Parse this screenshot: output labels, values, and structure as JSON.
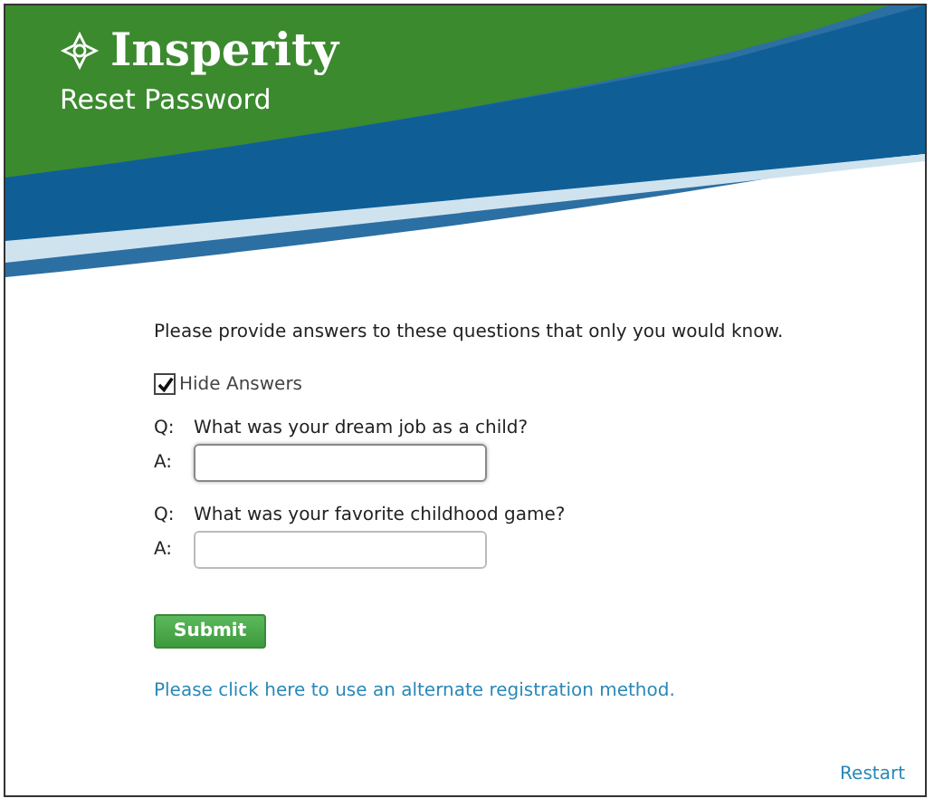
{
  "header": {
    "logo": "Insperity",
    "title": "Reset Password"
  },
  "intro": "Please provide answers to these questions that only you would know.",
  "hide_answers": {
    "label": "Hide Answers",
    "checked": true
  },
  "questions": [
    {
      "q_label": "Q:",
      "question": "What was your dream job as a child?",
      "a_label": "A:",
      "focused": true
    },
    {
      "q_label": "Q:",
      "question": "What was your favorite childhood game?",
      "a_label": "A:",
      "focused": false
    }
  ],
  "submit": "Submit",
  "alternate_link": "Please click here to use an alternate registration method.",
  "restart": "Restart"
}
